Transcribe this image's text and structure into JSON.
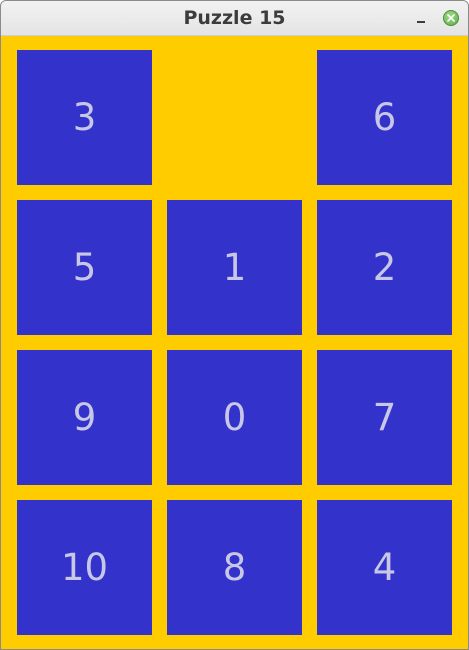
{
  "window": {
    "title": "Puzzle 15"
  },
  "board": {
    "tiles": [
      {
        "label": "3"
      },
      {
        "label": ""
      },
      {
        "label": "6"
      },
      {
        "label": "5"
      },
      {
        "label": "1"
      },
      {
        "label": "2"
      },
      {
        "label": "9"
      },
      {
        "label": "0"
      },
      {
        "label": "7"
      },
      {
        "label": "10"
      },
      {
        "label": "8"
      },
      {
        "label": "4"
      }
    ]
  },
  "colors": {
    "board_background": "#ffcc00",
    "tile_background": "#3333cc",
    "tile_text": "#c8c8e6"
  }
}
